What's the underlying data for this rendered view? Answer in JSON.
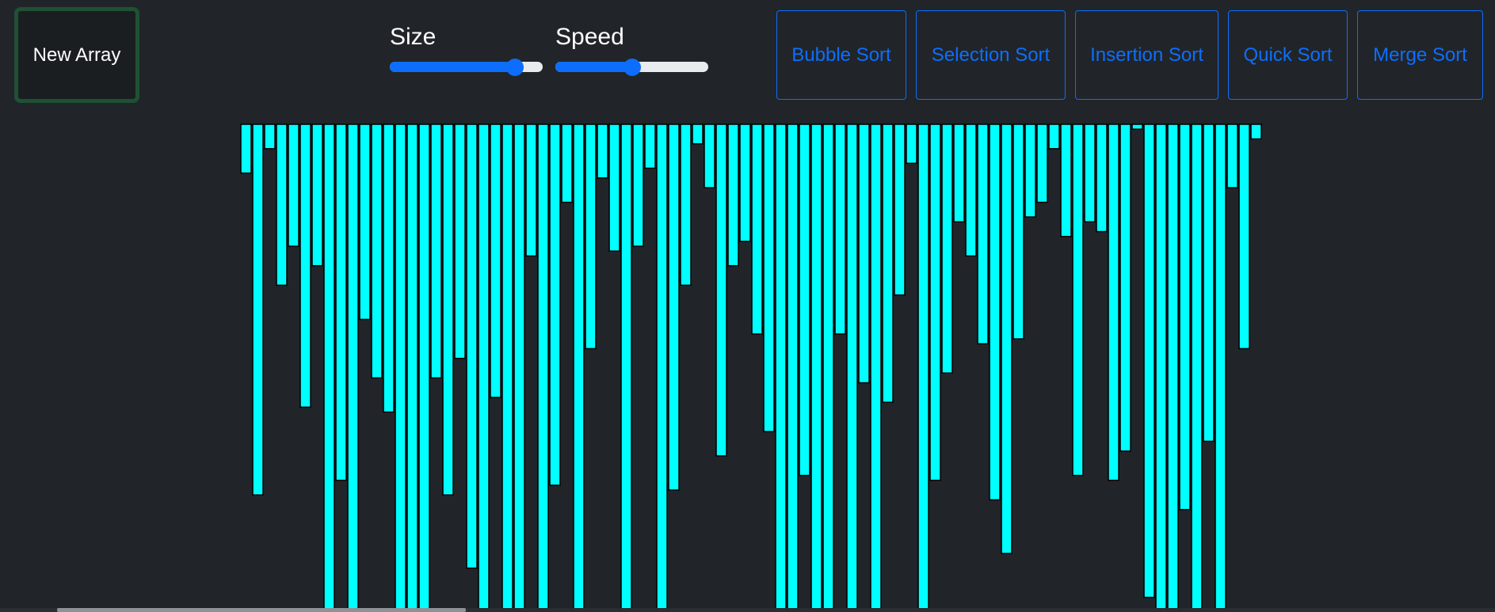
{
  "controls": {
    "new_array_label": "New Array",
    "size": {
      "label": "Size",
      "value_fraction": 0.82
    },
    "speed": {
      "label": "Speed",
      "value_fraction": 0.5
    }
  },
  "sort_buttons": [
    {
      "label": "Bubble Sort"
    },
    {
      "label": "Selection Sort"
    },
    {
      "label": "Insertion Sort"
    },
    {
      "label": "Quick Sort"
    },
    {
      "label": "Merge Sort"
    }
  ],
  "colors": {
    "background": "#212529",
    "bar_fill": "#00ffff",
    "bar_border": "#000000",
    "accent": "#0d6efd",
    "new_array_border": "#1f5135"
  },
  "array": {
    "count": 86,
    "max_value": 100,
    "values": [
      10,
      76,
      5,
      33,
      25,
      58,
      29,
      100,
      73,
      100,
      40,
      52,
      59,
      100,
      100,
      100,
      52,
      76,
      48,
      91,
      100,
      56,
      100,
      100,
      27,
      100,
      74,
      16,
      100,
      46,
      11,
      26,
      100,
      25,
      9,
      100,
      75,
      33,
      4,
      13,
      68,
      29,
      24,
      43,
      63,
      100,
      100,
      72,
      100,
      100,
      43,
      100,
      53,
      100,
      57,
      35,
      8,
      100,
      73,
      51,
      20,
      27,
      45,
      77,
      88,
      44,
      19,
      16,
      5,
      23,
      72,
      20,
      22,
      73,
      67,
      1,
      97,
      100,
      100,
      79,
      100,
      65,
      100,
      13,
      46,
      3
    ]
  }
}
